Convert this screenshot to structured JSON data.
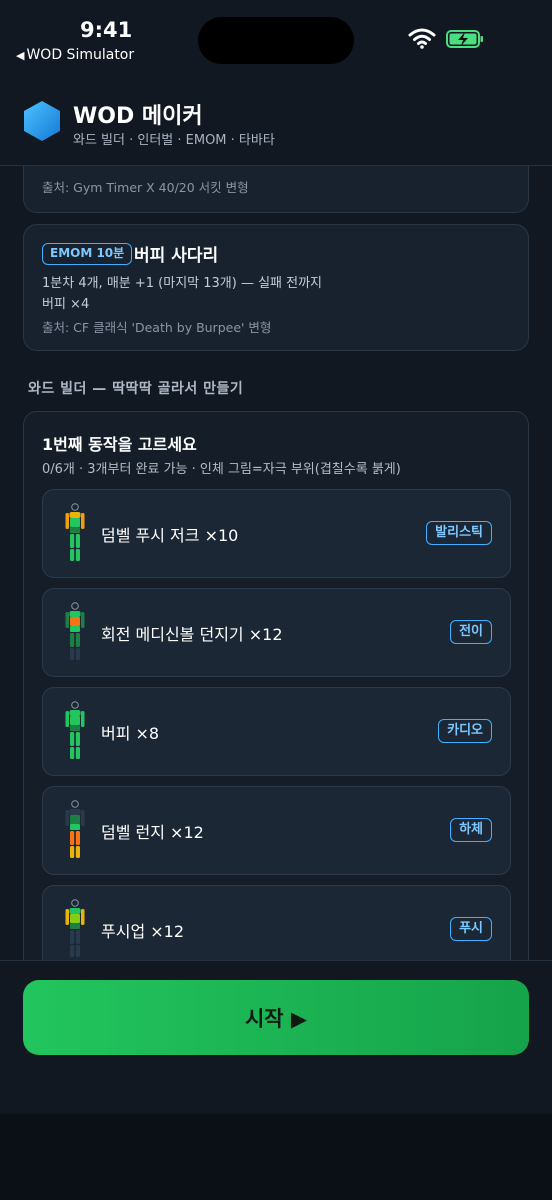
{
  "status_bar": {
    "time": "9:41",
    "back_app": "WOD Simulator"
  },
  "header": {
    "title": "WOD 메이커",
    "subtitle": "와드 빌더 · 인터벌 · EMOM · 타바타",
    "logo_icon": "hexagon-logo-icon"
  },
  "workouts": [
    {
      "source": "출처: Gym Timer X 40/20 서킷 변형"
    },
    {
      "badge": "EMOM 10분",
      "title": "버피 사다리",
      "description": "1분차 4개, 매분 +1 (마지막 13개) — 실패 전까지",
      "movement": "버피 ×4",
      "source": "출처: CF 클래식 'Death by Burpee' 변형"
    }
  ],
  "builder": {
    "section_title": "와드 빌더 — 딱딱딱 골라서 만들기",
    "title": "1번째 동작을 고르세요",
    "subtitle": "0/6개 · 3개부터 완료 가능 · 인체 그림=자극 부위(겹칠수록 붉게)",
    "movements": [
      {
        "label": "덤벨 푸시 저크 ×10",
        "tag": "발리스틱",
        "icon": "body-shoulders-arms-icon"
      },
      {
        "label": "회전 메디신볼 던지기 ×12",
        "tag": "전이",
        "icon": "body-core-icon"
      },
      {
        "label": "버피 ×8",
        "tag": "카디오",
        "icon": "body-full-icon"
      },
      {
        "label": "덤벨 런지 ×12",
        "tag": "하체",
        "icon": "body-legs-icon"
      },
      {
        "label": "푸시업 ×12",
        "tag": "푸시",
        "icon": "body-chest-icon"
      }
    ]
  },
  "footer": {
    "start_label": "시작 ▶"
  },
  "colors": {
    "accent": "#3fb0ff",
    "start_button": "#22c55e",
    "background": "#111821"
  }
}
